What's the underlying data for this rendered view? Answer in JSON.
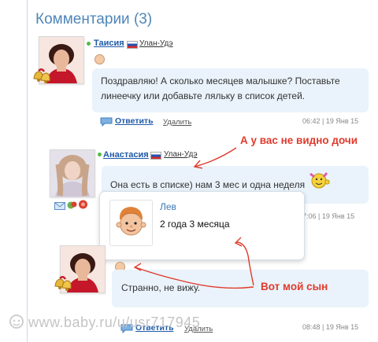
{
  "section": {
    "title": "Комментарии (3)"
  },
  "comments": [
    {
      "author": "Таисия",
      "city": "Улан-Удэ",
      "text": "Поздравляю! А сколько месяцев малышке? Поставьте линеечку или добавьте ляльку в список детей.",
      "reply_label": "Ответить",
      "delete_label": "Удалить",
      "time": "06:42 | 19 Янв 15"
    },
    {
      "author": "Анастасия",
      "city": "Улан-Удэ",
      "text": "Она есть в списке) нам 3 мес и одна неделя",
      "time": "7:06 | 19 Янв 15"
    },
    {
      "text": "Странно, не вижу.",
      "reply_label": "Ответить",
      "delete_label": "Удалить",
      "time": "08:48 | 19 Янв 15"
    }
  ],
  "child_popup": {
    "name": "Лев",
    "age": "2 года 3 месяца"
  },
  "annotations": {
    "top": "А у вас не видно дочи",
    "bottom": "Вот мой сын"
  },
  "watermark": "www.baby.ru/u/usr717945",
  "colors": {
    "accent": "#1f5aa8",
    "title": "#4f86b8",
    "bubble": "#eaf3fb",
    "annotation": "#e03a2c"
  }
}
